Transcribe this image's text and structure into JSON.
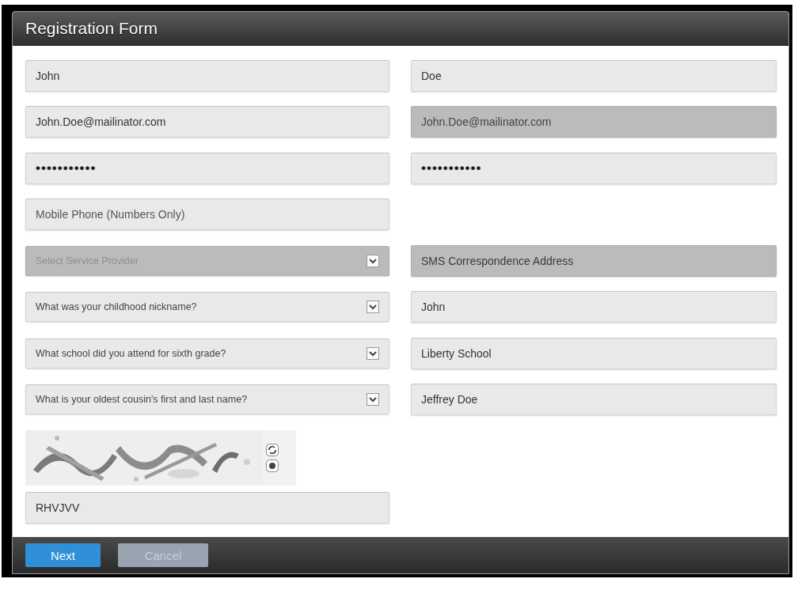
{
  "window": {
    "title": "Registration Form"
  },
  "rows": [
    {
      "left": {
        "kind": "text",
        "value": "John",
        "disabled": false
      },
      "right": {
        "kind": "text",
        "value": "Doe",
        "disabled": false
      }
    },
    {
      "left": {
        "kind": "text",
        "value": "John.Doe@mailinator.com",
        "disabled": false
      },
      "right": {
        "kind": "text",
        "value": "John.Doe@mailinator.com",
        "disabled": true
      }
    },
    {
      "left": {
        "kind": "password",
        "value": "•••••••••••",
        "disabled": false
      },
      "right": {
        "kind": "password",
        "value": "•••••••••••",
        "disabled": false
      }
    },
    {
      "left": {
        "kind": "text",
        "placeholder": "Mobile Phone (Numbers Only)",
        "disabled": false
      }
    },
    {
      "left": {
        "kind": "select",
        "placeholder": "Select Service Provider",
        "disabled": true
      },
      "right": {
        "kind": "text",
        "placeholder": "SMS Correspondence Address",
        "disabled": true
      }
    },
    {
      "left": {
        "kind": "select",
        "value": "What was your childhood nickname?",
        "disabled": false
      },
      "right": {
        "kind": "text",
        "value": "John",
        "disabled": false
      }
    },
    {
      "left": {
        "kind": "select",
        "value": "What school did you attend for sixth grade?",
        "disabled": false
      },
      "right": {
        "kind": "text",
        "value": "Liberty School",
        "disabled": false
      }
    },
    {
      "left": {
        "kind": "select",
        "value": "What is your oldest cousin's first and last name?",
        "disabled": false
      },
      "right": {
        "kind": "text",
        "value": "Jeffrey Doe",
        "disabled": false
      }
    }
  ],
  "captcha": {
    "answer": {
      "kind": "text",
      "value": "RHVJVV",
      "disabled": false
    }
  },
  "buttons": [
    {
      "label": "Next",
      "primary": true,
      "disabled": false
    },
    {
      "label": "Cancel",
      "primary": false,
      "disabled": true
    }
  ]
}
